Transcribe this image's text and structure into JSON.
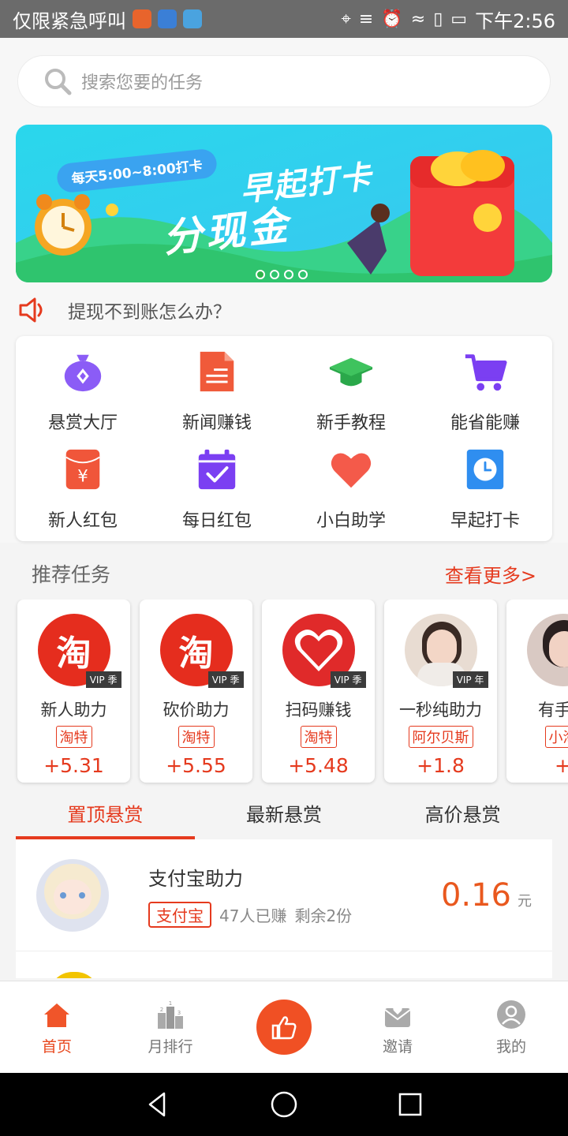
{
  "status_bar": {
    "carrier": "仅限紧急呼叫",
    "time": "下午2:56"
  },
  "search": {
    "placeholder": "搜索您要的任务"
  },
  "banner": {
    "pill": "每天5:00~8:00打卡",
    "title_line1": "早起打卡",
    "title_line2": "分现金",
    "slide_count": 4,
    "active_slide": 1
  },
  "notice": {
    "text": "提现不到账怎么办？"
  },
  "grid": {
    "items": [
      {
        "label": "悬赏大厅",
        "icon": "money-bag-icon"
      },
      {
        "label": "新闻赚钱",
        "icon": "document-icon"
      },
      {
        "label": "新手教程",
        "icon": "graduation-cap-icon"
      },
      {
        "label": "能省能赚",
        "icon": "shopping-cart-icon"
      },
      {
        "label": "新人红包",
        "icon": "red-envelope-icon"
      },
      {
        "label": "每日红包",
        "icon": "calendar-check-icon"
      },
      {
        "label": "小白助学",
        "icon": "heart-icon"
      },
      {
        "label": "早起打卡",
        "icon": "clock-icon"
      }
    ]
  },
  "recommend": {
    "title": "推荐任务",
    "more": "查看更多>",
    "cards": [
      {
        "name": "新人助力",
        "tag": "淘特",
        "price": "+5.31",
        "vip": "VIP 季"
      },
      {
        "name": "砍价助力",
        "tag": "淘特",
        "price": "+5.55",
        "vip": "VIP 季"
      },
      {
        "name": "扫码赚钱",
        "tag": "淘特",
        "price": "+5.48",
        "vip": "VIP 季"
      },
      {
        "name": "一秒纯助力",
        "tag": "阿尔贝斯",
        "price": "+1.8",
        "vip": "VIP 年"
      },
      {
        "name": "有手机",
        "tag": "小淘",
        "price": "+"
      }
    ]
  },
  "tabs": [
    {
      "label": "置顶悬赏",
      "active": true
    },
    {
      "label": "最新悬赏",
      "active": false
    },
    {
      "label": "高价悬赏",
      "active": false
    }
  ],
  "list": [
    {
      "title": "支付宝助力",
      "tag": "支付宝",
      "earned": "47人已赚",
      "remaining": "剩余2份",
      "price": "0.16",
      "unit": "元"
    }
  ],
  "bottom_nav": [
    {
      "label": "首页",
      "active": true,
      "icon": "home-icon"
    },
    {
      "label": "月排行",
      "active": false,
      "icon": "podium-icon"
    },
    {
      "label": "",
      "active": false,
      "icon": "thumbs-up-icon"
    },
    {
      "label": "邀请",
      "active": false,
      "icon": "invite-envelope-icon"
    },
    {
      "label": "我的",
      "active": false,
      "icon": "user-icon"
    }
  ],
  "colors": {
    "accent": "#e53a1e",
    "banner_bg": "#2fd4e8"
  }
}
